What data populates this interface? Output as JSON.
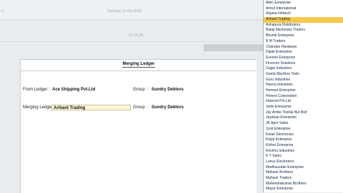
{
  "background": {
    "date_text": "Tuesday, 11-Oct-2022",
    "left_mark": "0",
    "number_text": "17-10-20"
  },
  "dialog": {
    "title": "Merging Ledger",
    "from_ledger_label": "From Ledger",
    "from_ledger_value": "Ace Shipping Pvt.Ltd",
    "group_label_1": "Group",
    "group_value_1": "Sundry Debtors",
    "merging_ledger_label": "Merging Ledger",
    "merging_ledger_value": "Arihant Trading",
    "group_label_2": "Group",
    "group_value_2": "Sundry Debtors",
    "colon": ":"
  },
  "ledger_list": {
    "selected_index": 3,
    "selected_color": "#f6c94a",
    "items": [
      "Allec Enterprise",
      "Amrut International",
      "Anjana Infotech",
      "Arihant Trading",
      "Ashapura Distributors",
      "Balaji Machinary Traders",
      "Bhumit Enterprise",
      "B M Traders",
      "Chandan Hardware",
      "Dipali Enterprise",
      "Everest Enterprise",
      "Firstcom Solutions",
      "Gajjar Industries",
      "Geeta Machine Tools",
      "Guru Industries",
      "Heena Industries",
      "Hemant Enterprise",
      "Honest Corporation",
      "Imperial Pvt.Ltd",
      "Janki Enterprise",
      "Jay Ambe Tools& Nut Bolt",
      "Jaydeep Enterprise",
      "JK Agro Sales",
      "Jyoti Enterprise",
      "Ketan Electronics",
      "Kinjal Enterprise",
      "Kishor Enterprise",
      "Krishna Industries",
      "K Y Sales",
      "Lunux Electronics",
      "Madhusudan Enterprise",
      "Mahavir Brothers",
      "Mahavir Traders",
      "Mahendrakumar Brothers",
      "Mayur Enterprise"
    ]
  }
}
